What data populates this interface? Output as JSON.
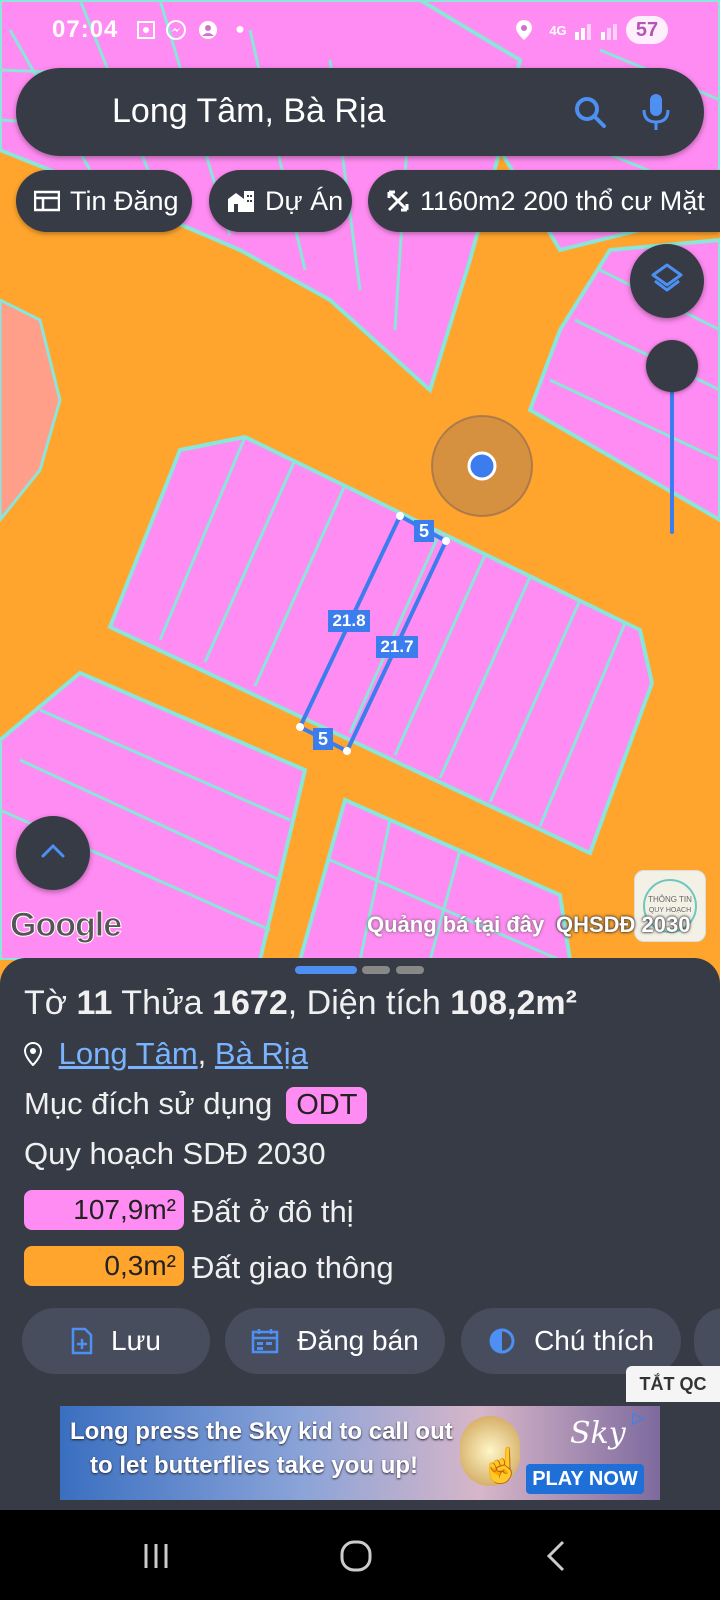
{
  "status_bar": {
    "time": "07:04",
    "network": "4G",
    "battery": "57"
  },
  "search": {
    "query": "Long Tâm, Bà Rịa"
  },
  "chips": [
    {
      "label": "Tin Đăng",
      "icon": "listing-icon"
    },
    {
      "label": "Dự Án",
      "icon": "buildings-icon"
    },
    {
      "label": "1160m2 200 thổ cư Mặt",
      "icon": "measure-icon"
    }
  ],
  "map": {
    "measurements": {
      "top": "5",
      "left": "21.8",
      "right": "21.7",
      "bottom": "5"
    },
    "google_label": "Google",
    "promo_text": "Quảng bá tại đây",
    "layer_label": "QHSDĐ 2030",
    "logo_text": "THÔNG TIN QUY HOẠCH"
  },
  "sheet": {
    "title": {
      "prefix": "Tờ ",
      "sheet_no": "11",
      "mid": " Thửa ",
      "parcel_no": "1672",
      "sep": ", Diện tích ",
      "area": "108,2m²"
    },
    "location": {
      "ward": "Long Tâm",
      "comma": ",",
      "city": "Bà Rịa"
    },
    "usage": {
      "label": "Mục đích sử dụng",
      "code": "ODT"
    },
    "plan_title": "Quy hoạch SDĐ 2030",
    "plan_items": [
      {
        "value": "107,9m²",
        "label": "Đất ở đô thị",
        "color": "#ff8cf2"
      },
      {
        "value": "0,3m²",
        "label": "Đất giao thông",
        "color": "#ffa42d"
      }
    ],
    "actions": [
      {
        "label": "Lưu",
        "icon": "save-plus-icon"
      },
      {
        "label": "Đăng bán",
        "icon": "calendar-icon"
      },
      {
        "label": "Chú thích",
        "icon": "contrast-icon"
      }
    ],
    "hide_ads": "TẮT QC"
  },
  "ad": {
    "line1": "Long press the Sky kid to call out",
    "line2": "to let butterflies take you up!",
    "brand": "Sky",
    "cta": "PLAY NOW"
  },
  "colors": {
    "road": "#ffa42d",
    "residential": "#ff8cf2",
    "parcel_border": "#8be5d8",
    "selection": "#3b7ded",
    "panel": "#363b46"
  }
}
